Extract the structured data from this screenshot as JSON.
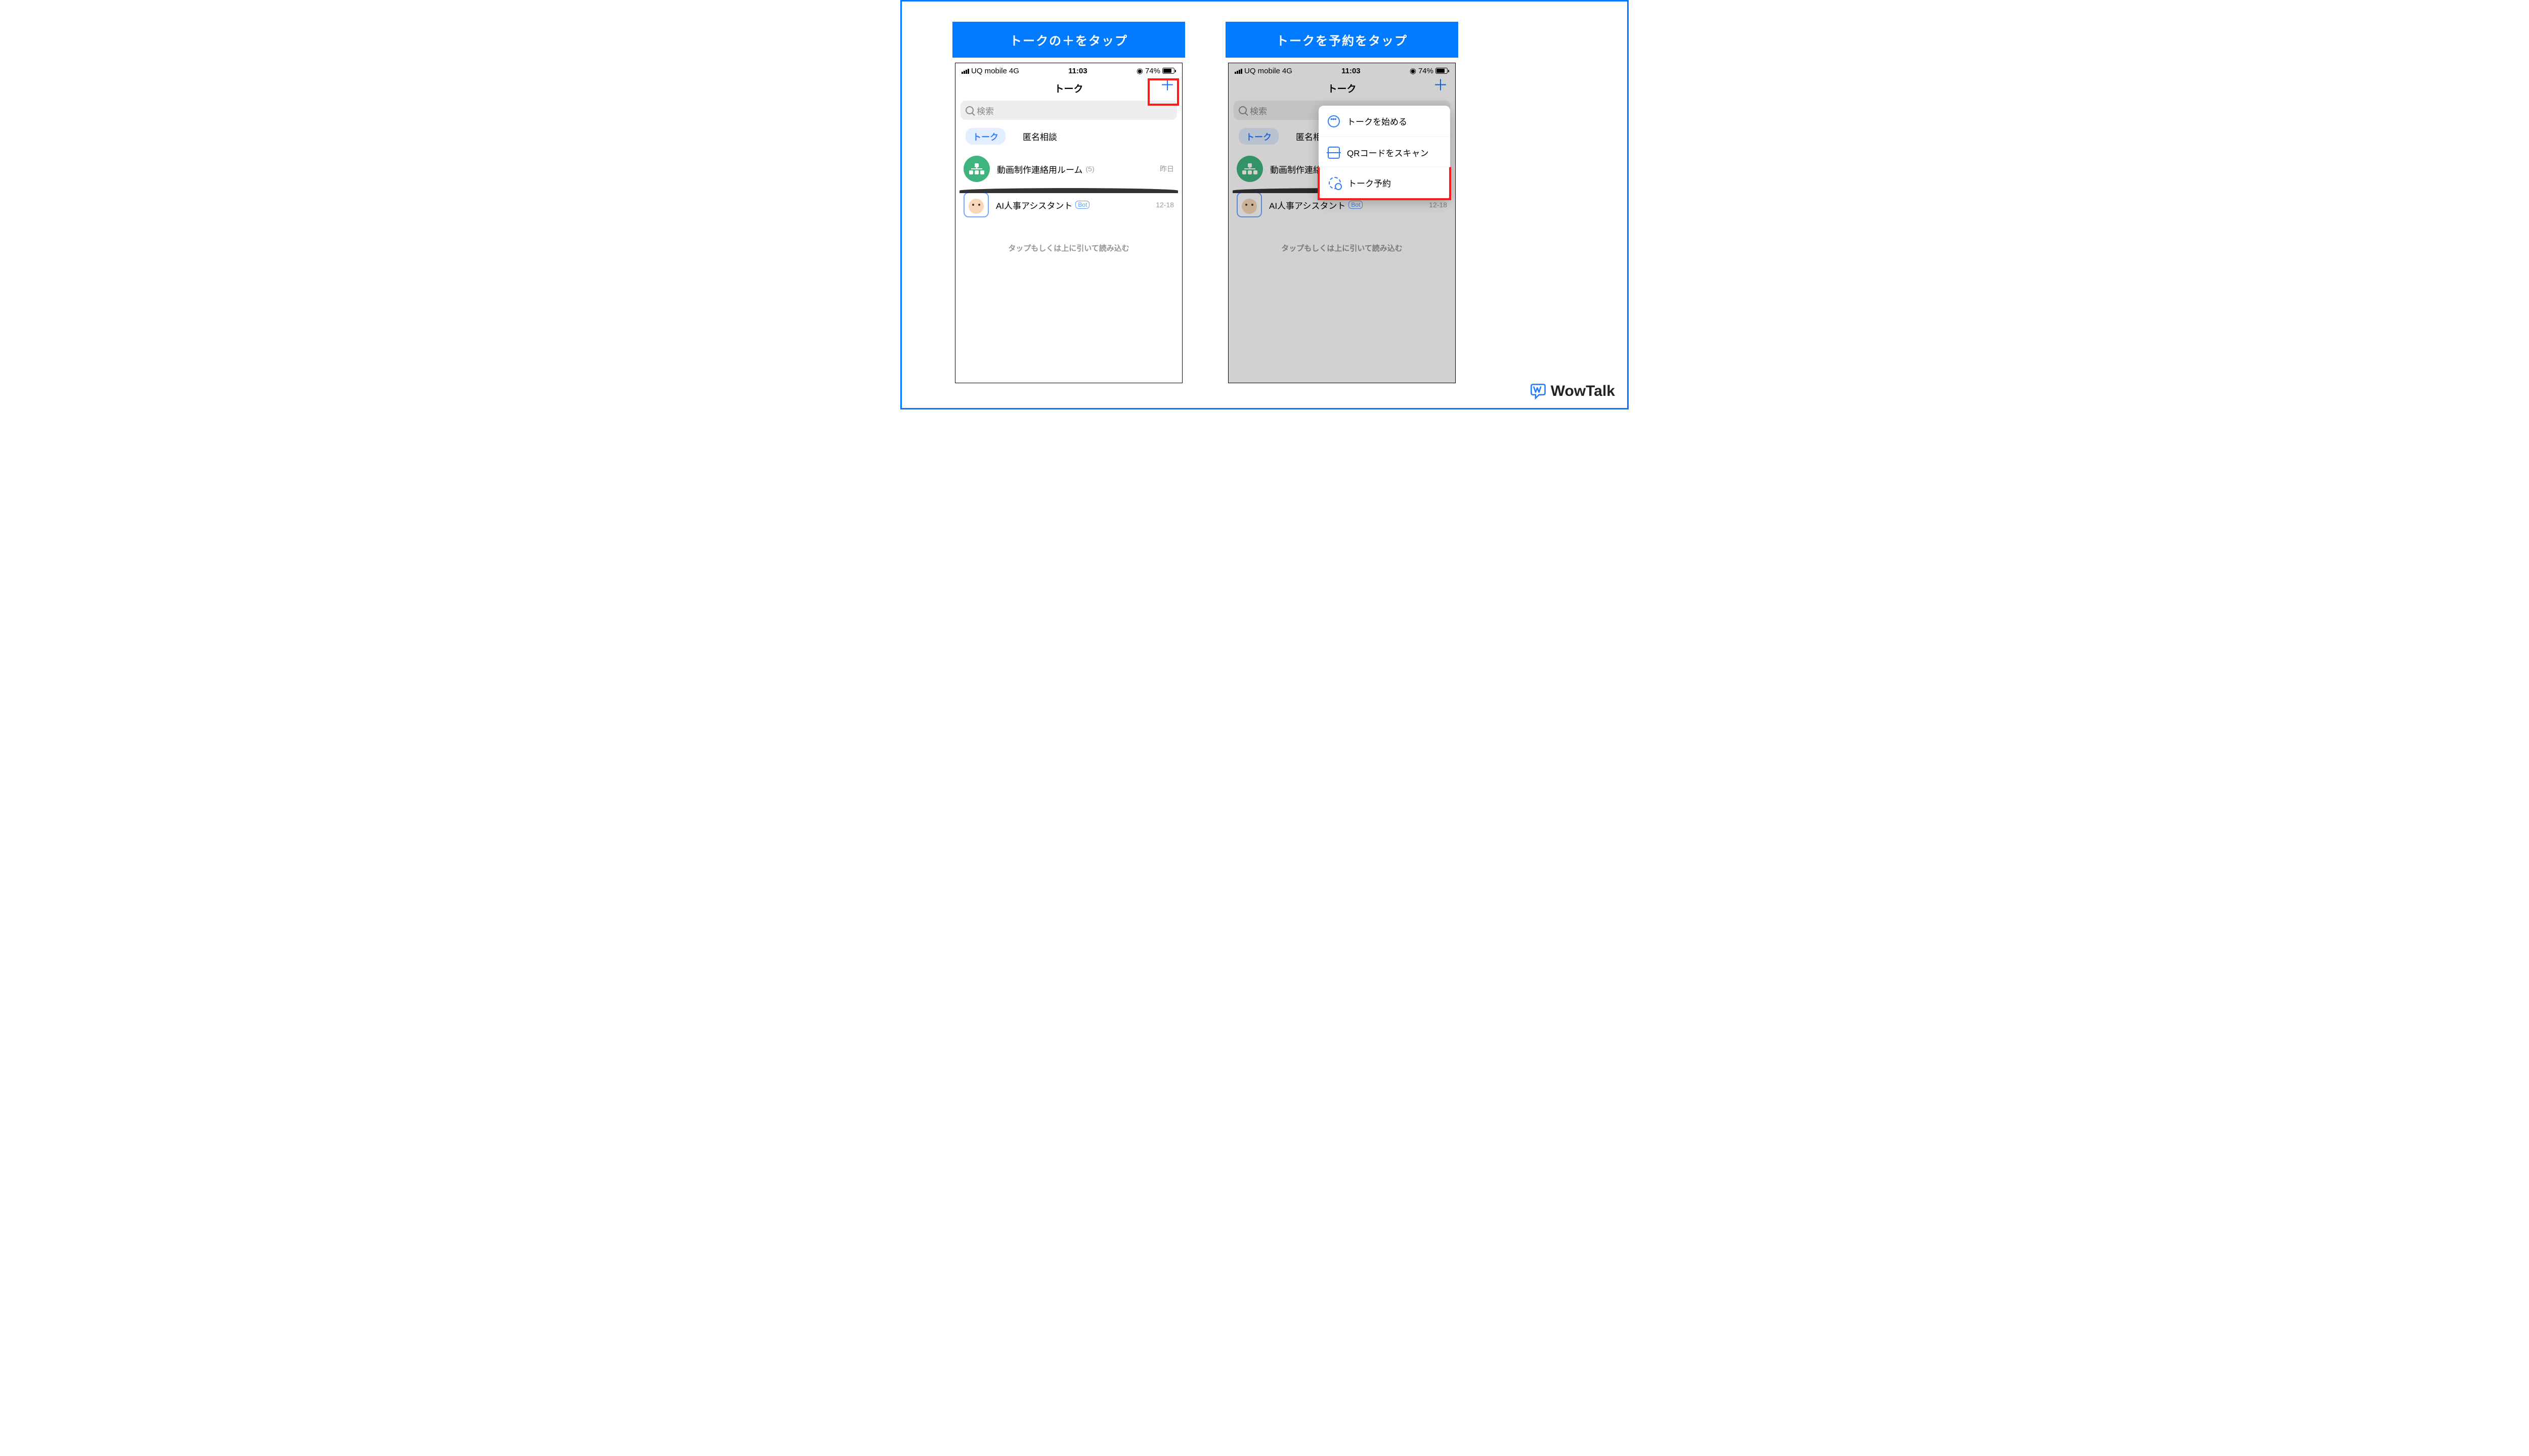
{
  "banners": {
    "left": "トークの＋をタップ",
    "right": "トークを予約をタップ"
  },
  "statusbar": {
    "carrier": "UQ mobile",
    "network": "4G",
    "time": "11:03",
    "battery_pct": "74%"
  },
  "nav": {
    "title": "トーク",
    "plus": "＋"
  },
  "search": {
    "placeholder": "検索"
  },
  "tabs": {
    "active": "トーク",
    "other": "匿名相談"
  },
  "rows": [
    {
      "title": "動画制作連絡用ルーム",
      "count": "(5)",
      "time": "昨日"
    },
    {
      "title": "AI人事アシスタント",
      "badge": "Bot",
      "time": "12-18"
    }
  ],
  "pull_hint": "タップもしくは上に引いて読み込む",
  "popover": {
    "items": [
      {
        "label": "トークを始める"
      },
      {
        "label": "QRコードをスキャン"
      },
      {
        "label": "トーク予約"
      }
    ]
  },
  "brand": "WowTalk",
  "location_symbol": "◉"
}
